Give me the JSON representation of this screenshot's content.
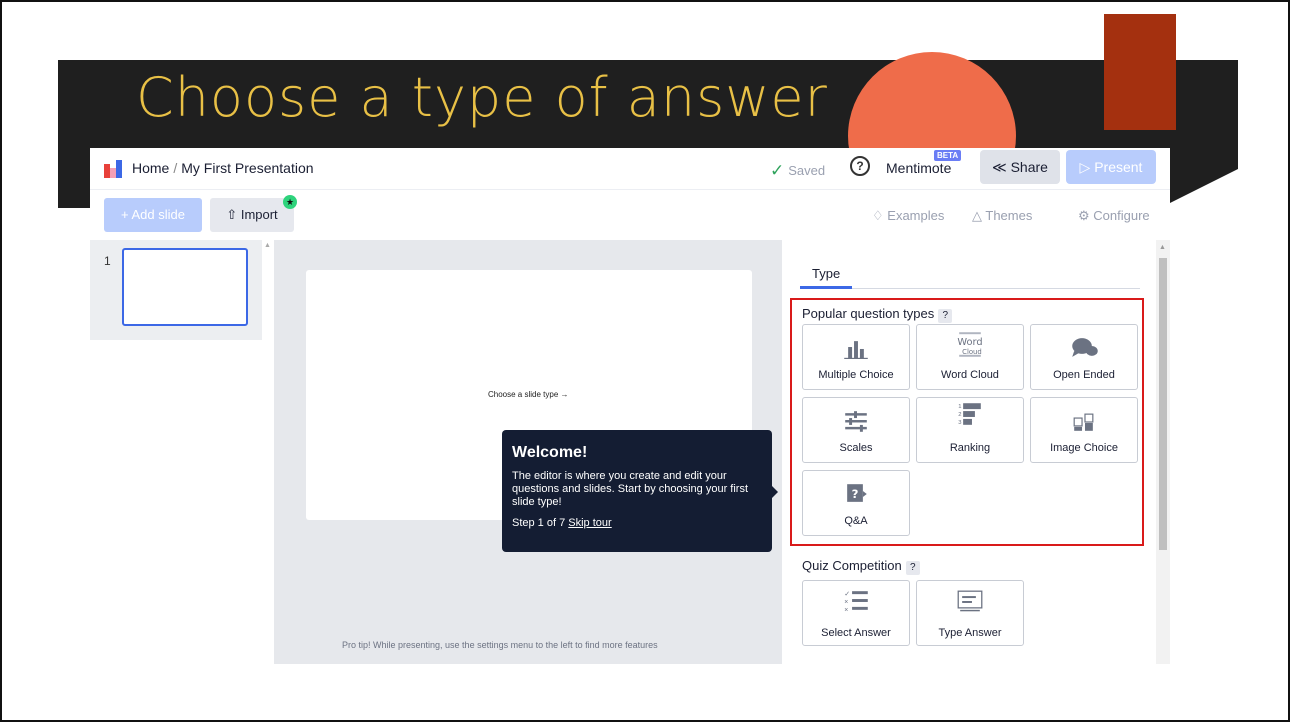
{
  "slide": {
    "title": "Choose a type of answer"
  },
  "app": {
    "breadcrumb_home": "Home",
    "breadcrumb_sep": "/",
    "breadcrumb_title": "My First Presentation",
    "saved": "Saved",
    "mentimote": "Mentimote",
    "beta": "BETA",
    "share": "Share",
    "present": "Present",
    "add_slide": "+ Add slide",
    "import": "Import",
    "examples": "Examples",
    "themes": "Themes",
    "configure": "Configure",
    "thumb_number": "1",
    "choose_hint": "Choose a slide type",
    "pro_tip": "Pro tip! While presenting, use the settings menu to the left to find more features"
  },
  "tour": {
    "title": "Welcome!",
    "body": "The editor is where you create and edit your questions and slides. Start by choosing your first slide type!",
    "step": "Step 1 of 7",
    "skip": "Skip tour"
  },
  "panel": {
    "tab": "Type",
    "popular_title": "Popular question types",
    "quiz_title": "Quiz Competition",
    "help": "?",
    "popular": [
      {
        "label": "Multiple Choice",
        "icon": "bar-chart-icon"
      },
      {
        "label": "Word Cloud",
        "icon": "word-cloud-icon"
      },
      {
        "label": "Open Ended",
        "icon": "speech-bubbles-icon"
      },
      {
        "label": "Scales",
        "icon": "sliders-icon"
      },
      {
        "label": "Ranking",
        "icon": "ranking-icon"
      },
      {
        "label": "Image Choice",
        "icon": "image-choice-icon"
      },
      {
        "label": "Q&A",
        "icon": "qa-icon"
      }
    ],
    "quiz": [
      {
        "label": "Select Answer",
        "icon": "select-answer-icon"
      },
      {
        "label": "Type Answer",
        "icon": "type-answer-icon"
      }
    ]
  },
  "colors": {
    "title": "#e8c046",
    "accent": "#3c68e6",
    "highlight_border": "#d91a1a",
    "orange": "#ef6c4a",
    "dark_red": "#a4300f"
  }
}
